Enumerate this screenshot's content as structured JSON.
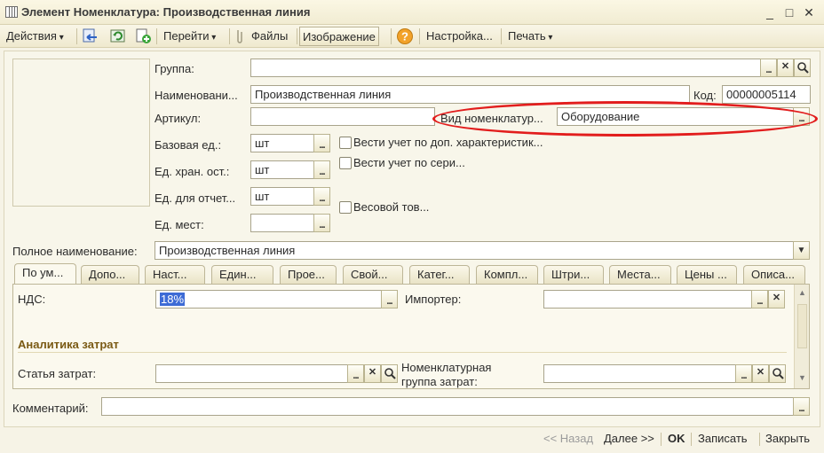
{
  "window": {
    "title": "Элемент Номенклатура: Производственная линия",
    "controls": [
      "_",
      "□",
      "✕"
    ]
  },
  "toolbar": {
    "actions_label": "Действия",
    "goto_label": "Перейти",
    "files_label": "Файлы",
    "image_label": "Изображение",
    "help_label": "?",
    "settings_label": "Настройка...",
    "print_label": "Печать"
  },
  "form": {
    "group_label": "Группа:",
    "group_value": "",
    "name_label": "Наименовани...",
    "name_value": "Производственная линия",
    "code_label": "Код:",
    "code_value": "00000005114",
    "article_label": "Артикул:",
    "article_value": "",
    "nomenclature_kind_label": "Вид номенклатур...",
    "nomenclature_kind_value": "Оборудование",
    "base_unit_label": "Базовая ед.:",
    "base_unit_value": "шт",
    "storage_unit_label": "Ед. хран. ост.:",
    "storage_unit_value": "шт",
    "report_unit_label": "Ед. для отчет...",
    "report_unit_value": "шт",
    "places_unit_label": "Ед. мест:",
    "places_unit_value": "",
    "chk_characteristics_label": "Вести учет по доп. характеристик...",
    "chk_series_label": "Вести учет по сери...",
    "chk_weight_label": "Весовой тов...",
    "full_name_label": "Полное наименование:",
    "full_name_value": "Производственная линия",
    "comment_label": "Комментарий:",
    "comment_value": ""
  },
  "tabs": [
    {
      "label": "По ум..."
    },
    {
      "label": "Допо..."
    },
    {
      "label": "Наст..."
    },
    {
      "label": "Един..."
    },
    {
      "label": "Прое..."
    },
    {
      "label": "Свой..."
    },
    {
      "label": "Катег..."
    },
    {
      "label": "Компл..."
    },
    {
      "label": "Штри..."
    },
    {
      "label": "Места..."
    },
    {
      "label": "Цены ..."
    },
    {
      "label": "Описа..."
    }
  ],
  "tab_default": {
    "vat_label": "НДС:",
    "vat_value": "18%",
    "importer_label": "Импортер:",
    "importer_value": "",
    "section_title": "Аналитика затрат",
    "cost_item_label": "Статья затрат:",
    "cost_item_value": "",
    "cost_group_label": "Номенклатурная группа затрат:",
    "cost_group_label_line1": "Номенклатурная",
    "cost_group_label_line2": "группа затрат:",
    "cost_group_value": ""
  },
  "bottom": {
    "back_label": "<< Назад",
    "next_label": "Далее >>",
    "ok_label": "OK",
    "save_label": "Записать",
    "close_label": "Закрыть"
  },
  "colors": {
    "highlight": "#e21d1d",
    "section_title": "#7a5a14",
    "selection": "#3d6bd6"
  }
}
